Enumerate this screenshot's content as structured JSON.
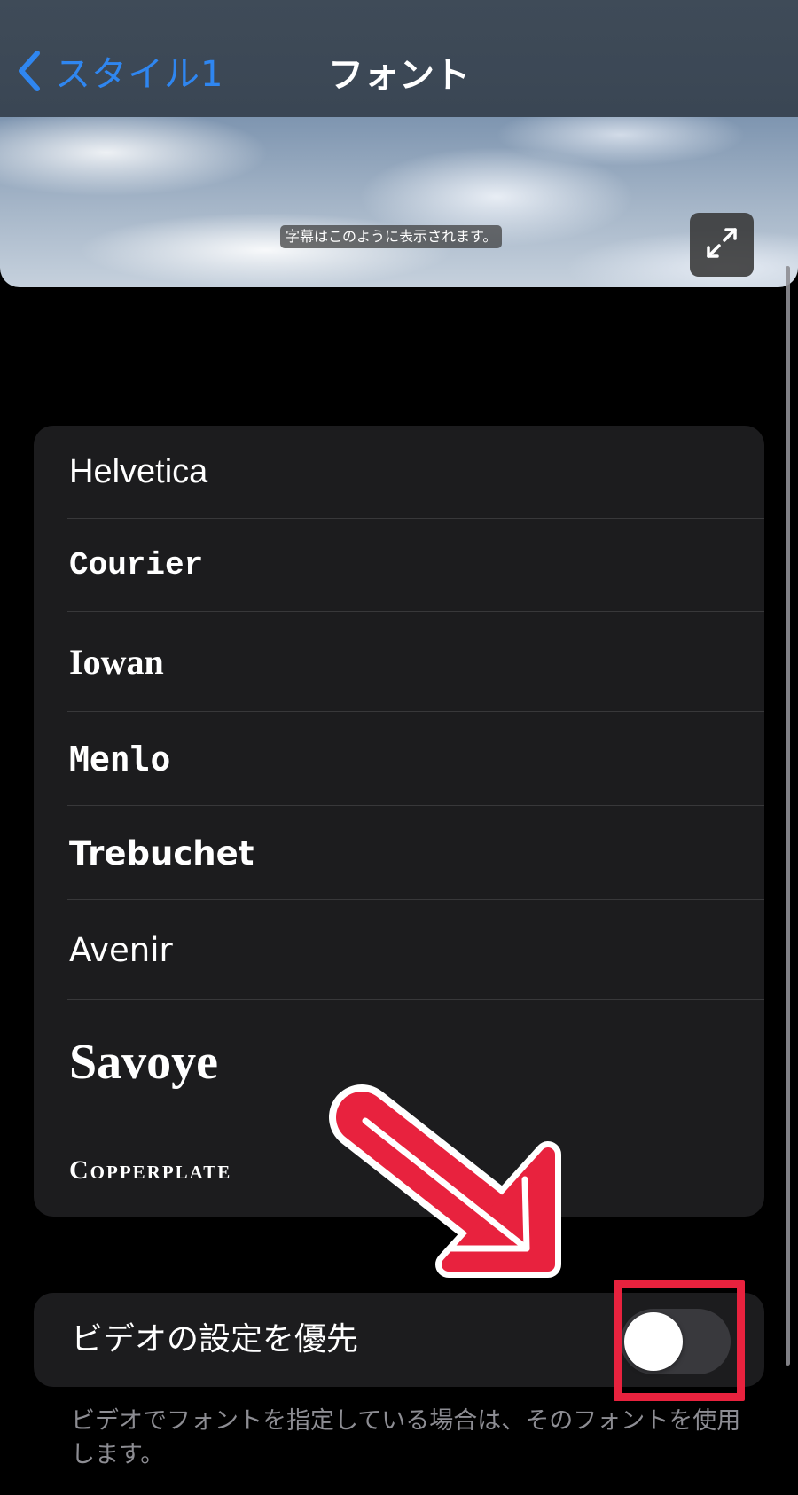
{
  "nav": {
    "back_label": "スタイル1",
    "title": "フォント"
  },
  "preview": {
    "caption": "字幕はこのように表示されます。",
    "expand_icon": "expand-arrows-icon"
  },
  "fonts": [
    {
      "label": "Helvetica"
    },
    {
      "label": "Courier"
    },
    {
      "label": "Iowan"
    },
    {
      "label": "Menlo"
    },
    {
      "label": "Trebuchet"
    },
    {
      "label": "Avenir"
    },
    {
      "label": "Savoye"
    },
    {
      "label": "Copperplate"
    }
  ],
  "video_override": {
    "label": "ビデオの設定を優先",
    "enabled": false,
    "note": "ビデオでフォントを指定している場合は、そのフォントを使用します。"
  },
  "colors": {
    "accent": "#2f86f0",
    "annotation": "#e8223e"
  }
}
